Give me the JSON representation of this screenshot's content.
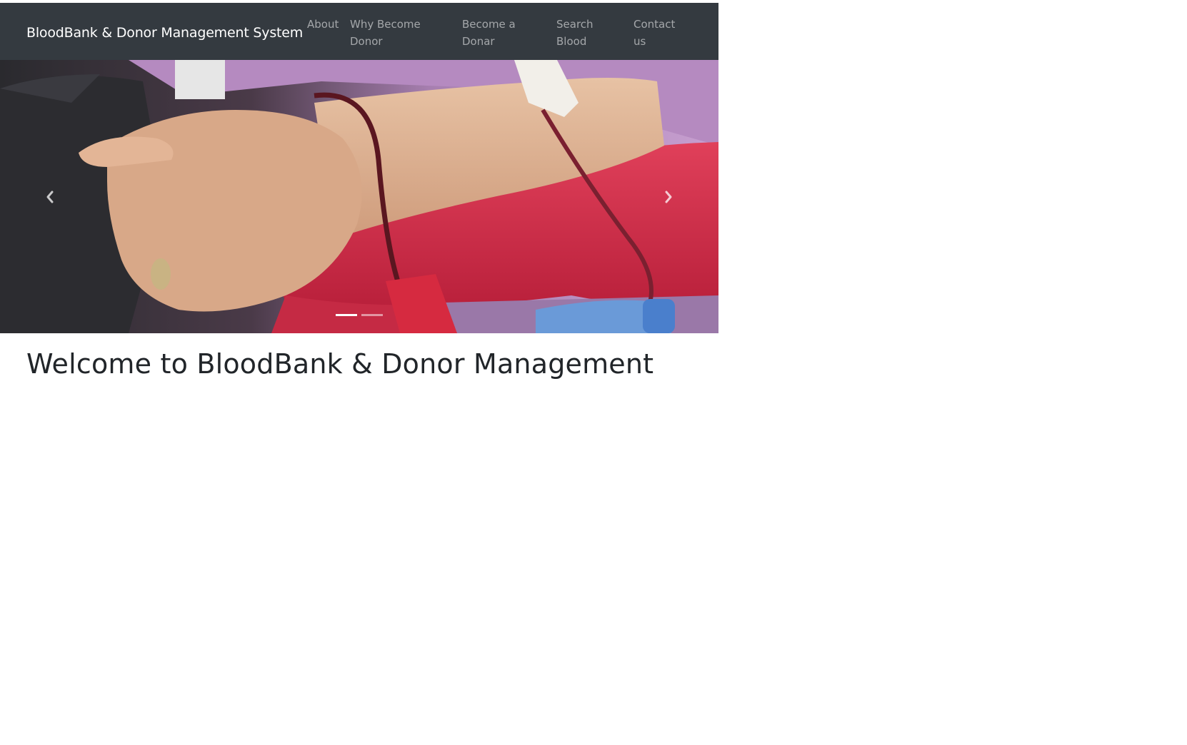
{
  "navbar": {
    "brand": "BloodBank & Donor Management System",
    "links": [
      {
        "line1": "About",
        "line2": ""
      },
      {
        "line1": "Why Become",
        "line2": "Donor"
      },
      {
        "line1": "Become a",
        "line2": "Donar"
      },
      {
        "line1": "Search",
        "line2": "Blood"
      },
      {
        "line1": "Contact",
        "line2": "us"
      }
    ]
  },
  "carousel": {
    "slide_count": 2,
    "active_slide": 1,
    "prev_icon": "chevron-left-icon",
    "next_icon": "chevron-right-icon"
  },
  "main": {
    "heading": "Welcome to BloodBank & Donor Management"
  },
  "colors": {
    "navbar_bg": "#343a40",
    "nav_link": "rgba(255,255,255,0.55)",
    "brand": "#ffffff",
    "heading": "#212529"
  }
}
